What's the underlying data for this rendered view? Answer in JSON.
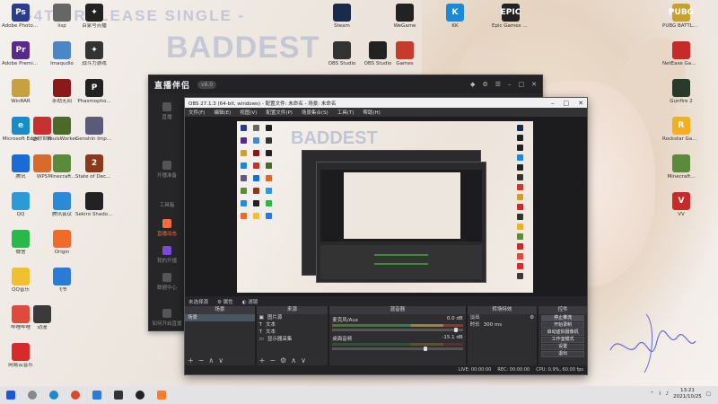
{
  "wallpaper": {
    "banner_text": "-4TH RELEASE SINGLE -",
    "logo_text": "BADDEST"
  },
  "desktop_icons": [
    {
      "id": "ps",
      "label": "Adobe Photosho...",
      "color": "#2b3c8f",
      "glyph": "Ps"
    },
    {
      "id": "unk1",
      "label": "lisp",
      "color": "#666",
      "glyph": ""
    },
    {
      "id": "bd1",
      "label": "百家号点播",
      "color": "#222",
      "glyph": "✦"
    },
    {
      "id": "pr",
      "label": "Adobe Premiere Pr...",
      "color": "#5a2a8a",
      "glyph": "Pr"
    },
    {
      "id": "fx",
      "label": "Imaqudio",
      "color": "#4a86c8",
      "glyph": ""
    },
    {
      "id": "fight",
      "label": "战斗力游戏",
      "color": "#333",
      "glyph": "✦"
    },
    {
      "id": "winrar",
      "label": "WinRAR",
      "color": "#c8a040",
      "glyph": ""
    },
    {
      "id": "naraka",
      "label": "永劫无间",
      "color": "#8a1a1a",
      "glyph": ""
    },
    {
      "id": "phasmo",
      "label": "Phasmopho...",
      "color": "#222",
      "glyph": "P"
    },
    {
      "id": "edge",
      "label": "Microsoft Edge",
      "color": "#1a8acb",
      "glyph": "e"
    },
    {
      "id": "kuwo",
      "label": "迷你世界",
      "color": "#c83030",
      "glyph": ""
    },
    {
      "id": "souls",
      "label": "SoulsWorker",
      "color": "#4a6a2a",
      "glyph": ""
    },
    {
      "id": "genshin",
      "label": "Genshin Impact",
      "color": "#5a5a7a",
      "glyph": ""
    },
    {
      "id": "tv",
      "label": "腾讯",
      "color": "#1a6ad8",
      "glyph": ""
    },
    {
      "id": "wj",
      "label": "WPS",
      "color": "#d86a2a",
      "glyph": ""
    },
    {
      "id": "mc",
      "label": "Minecraft...",
      "color": "#5a8a3a",
      "glyph": ""
    },
    {
      "id": "sod2",
      "label": "State of Decay 2",
      "color": "#8a3a1a",
      "glyph": "2"
    },
    {
      "id": "qq",
      "label": "QQ",
      "color": "#2a9ad8",
      "glyph": ""
    },
    {
      "id": "mail",
      "label": "腾讯会议",
      "color": "#2a8ad8",
      "glyph": ""
    },
    {
      "id": "sekiro",
      "label": "Sekiro Shadows...",
      "color": "#222",
      "glyph": ""
    },
    {
      "id": "wechat",
      "label": "微信",
      "color": "#2ab84a",
      "glyph": ""
    },
    {
      "id": "origin",
      "label": "Origin",
      "color": "#f06a2a",
      "glyph": ""
    },
    {
      "id": "qq2",
      "label": "QQ音乐",
      "color": "#f0c030",
      "glyph": ""
    },
    {
      "id": "feishu",
      "label": "飞书",
      "color": "#2a7ad8",
      "glyph": ""
    },
    {
      "id": "steam",
      "label": "Steam",
      "color": "#1a2a4a",
      "glyph": ""
    },
    {
      "id": "obs",
      "label": "OBS Studio",
      "color": "#222",
      "glyph": ""
    },
    {
      "id": "wegame",
      "label": "WeGame",
      "color": "#222",
      "glyph": ""
    },
    {
      "id": "kk",
      "label": "KK",
      "color": "#1a8ad8",
      "glyph": "K"
    },
    {
      "id": "epic",
      "label": "Epic Games Launcher",
      "color": "#222",
      "glyph": "EPIC"
    },
    {
      "id": "obsi",
      "label": "OBS Studio",
      "color": "#333",
      "glyph": ""
    },
    {
      "id": "game1",
      "label": "Games",
      "color": "#c83a2a",
      "glyph": ""
    },
    {
      "id": "pubg",
      "label": "PUBG BATTLEGROUNDS",
      "color": "#c8a030",
      "glyph": "PUBG"
    },
    {
      "id": "ng",
      "label": "NetEase Games",
      "color": "#c82a2a",
      "glyph": ""
    },
    {
      "id": "gunfire",
      "label": "Gunfire 2",
      "color": "#2a3a2a",
      "glyph": ""
    },
    {
      "id": "rockstar",
      "label": "Rockstar Games...",
      "color": "#f0b020",
      "glyph": "R"
    },
    {
      "id": "mc2",
      "label": "Minecraft...",
      "color": "#5a8a3a",
      "glyph": ""
    },
    {
      "id": "vv",
      "label": "VV",
      "color": "#c82a2a",
      "glyph": "V"
    },
    {
      "id": "live1",
      "label": "哔哩哔哩",
      "color": "#e04a3a",
      "glyph": ""
    },
    {
      "id": "wy",
      "label": "网易云音乐",
      "color": "#d82a2a",
      "glyph": ""
    },
    {
      "id": "ani",
      "label": "动漫",
      "color": "#3a3a3a",
      "glyph": ""
    }
  ],
  "xiuxiu": {
    "logo": "直播伴侣",
    "version": "v6.0",
    "sidebar": [
      {
        "label": "直播"
      },
      {
        "label": "开播准备"
      },
      {
        "label": "工具箱"
      },
      {
        "label": "直播动态"
      },
      {
        "label": "我的开播"
      },
      {
        "label": "数据中心"
      },
      {
        "label": "如何开启直播"
      }
    ]
  },
  "obs": {
    "title": "OBS 27.1.3 (64-bit, windows) - 配置文件: 未命名 - 场景: 未命名",
    "menu": [
      "文件(F)",
      "编辑(E)",
      "视图(V)",
      "配置文件(P)",
      "场景集合(S)",
      "工具(T)",
      "帮助(H)"
    ],
    "strip": {
      "no_source": "未选择源",
      "props": "属性",
      "filters": "滤镜"
    },
    "docks": {
      "scenes_header": "场景",
      "sources_header": "来源",
      "mixer_header": "混音器",
      "transitions_header": "转场特效",
      "controls_header": "控件"
    },
    "scenes": [
      "场景"
    ],
    "sources": [
      "图片源",
      "文本",
      "文本",
      "显示器采集"
    ],
    "mixer": [
      {
        "name": "麦克风/Aux",
        "db": "0.0 dB"
      },
      {
        "name": "桌面音频",
        "db": "-15.1 dB"
      }
    ],
    "transitions": {
      "type": "淡出",
      "duration_label": "时长",
      "duration_value": "300 ms"
    },
    "controls": [
      "停止推流",
      "开始录制",
      "启动虚拟摄像机",
      "工作室模式",
      "设置",
      "退出"
    ],
    "status": [
      "LIVE: 00:00:00",
      "REC: 00:00:00",
      "CPU: 0.9%, 60.00 fps"
    ]
  },
  "taskbar": {
    "time": "13:21",
    "date": "2021/10/25"
  }
}
